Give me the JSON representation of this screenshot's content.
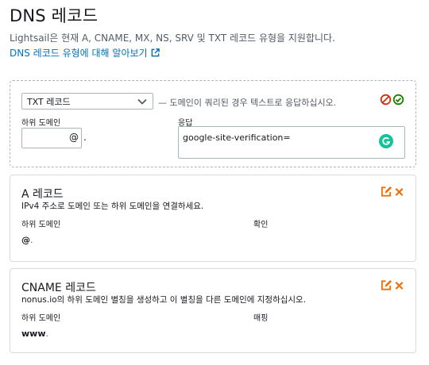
{
  "page": {
    "title": "DNS 레코드",
    "description": "Lightsail은 현재 A, CNAME, MX, NS, SRV 및 TXT 레코드 유형을 지원합니다.",
    "help_link": "DNS 레코드 유형에 대해 알아보기"
  },
  "edit_record": {
    "type_selected": "TXT 레코드",
    "type_hint": "— 도메인이 쿼리된 경우 텍스트로 응답하십시오.",
    "subdomain_label": "하위 도메인",
    "subdomain_value": "",
    "subdomain_suffix": "@",
    "separator": ".",
    "answer_label": "응답",
    "answer_value": "google-site-verification="
  },
  "records": [
    {
      "title": "A 레코드",
      "description": "IPv4 주소로 도메인 또는 하위 도메인을 연결하세요.",
      "col1_label": "하위 도메인",
      "col2_label": "확인",
      "subdomain": "@",
      "suffix": "."
    },
    {
      "title": "CNAME 레코드",
      "description": "nonus.io의 하위 도메인 별칭을 생성하고 이 별칭을 다른 도메인에 지정하십시오.",
      "col1_label": "하위 도메인",
      "col2_label": "매핑",
      "subdomain": "www",
      "suffix": "."
    }
  ],
  "colors": {
    "link": "#0073bb",
    "delete": "#d13212",
    "confirm": "#1d8102",
    "edit_orange": "#ec7211",
    "grammarly": "#15c39a"
  },
  "icons": [
    "external-link-icon",
    "chevron-down-icon",
    "cancel-icon",
    "confirm-icon",
    "grammarly-icon",
    "edit-icon",
    "delete-icon"
  ]
}
